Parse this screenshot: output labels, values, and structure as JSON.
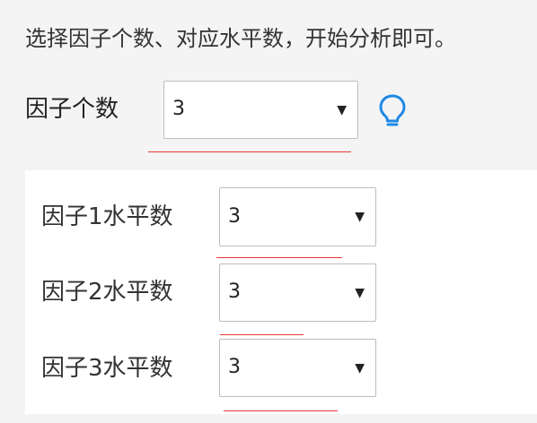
{
  "instruction": "选择因子个数、对应水平数，开始分析即可。",
  "factor_count": {
    "label": "因子个数",
    "value": "3",
    "hint_icon": "lightbulb-icon",
    "hint_icon_color": "#1e88e5"
  },
  "levels": [
    {
      "label": "因子1水平数",
      "value": "3"
    },
    {
      "label": "因子2水平数",
      "value": "3"
    },
    {
      "label": "因子3水平数",
      "value": "3"
    }
  ],
  "colors": {
    "annotation_underline": "#e53935",
    "panel_background": "#ffffff",
    "page_background": "#f4f4f4"
  }
}
